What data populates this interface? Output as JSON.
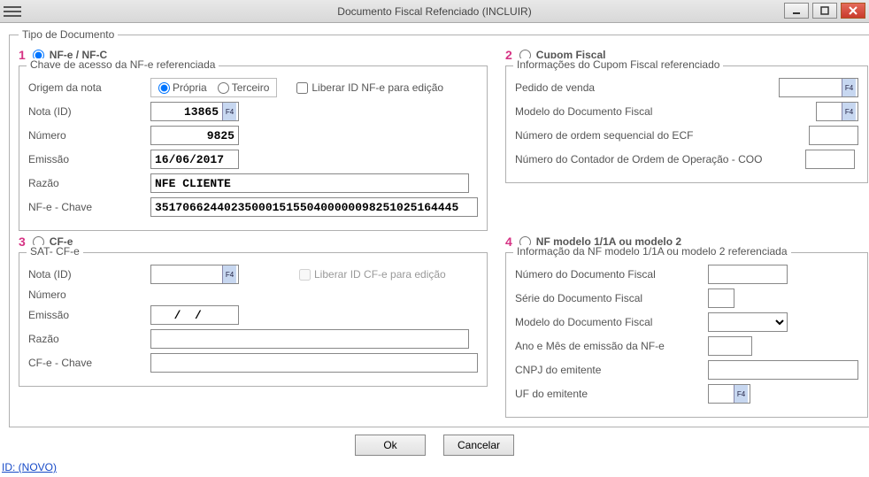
{
  "window": {
    "title": "Documento Fiscal Refenciado (INCLUIR)"
  },
  "legend_tipo": "Tipo de Documento",
  "badges": {
    "b1": "1",
    "b2": "2",
    "b3": "3",
    "b4": "4"
  },
  "sec1": {
    "radio_label": "NF-e / NF-C",
    "subtitle": "Chave de acesso da NF-e referenciada",
    "origem_label": "Origem da nota",
    "origem_propria": "Própria",
    "origem_terceiro": "Terceiro",
    "liberar_label": "Liberar ID NF-e para edição",
    "nota_label": "Nota (ID)",
    "nota_value": "13865",
    "numero_label": "Número",
    "numero_value": "9825",
    "emissao_label": "Emissão",
    "emissao_value": "16/06/2017",
    "razao_label": "Razão",
    "razao_value": "NFE CLIENTE",
    "chave_label": "NF-e - Chave",
    "chave_value": "35170662440235000151550400000098251025164445"
  },
  "sec2": {
    "radio_label": "Cupom Fiscal",
    "subtitle": "Informações do Cupom Fiscal referenciado",
    "pedido_label": "Pedido de venda",
    "modelo_label": "Modelo do Documento Fiscal",
    "ordem_label": "Número de ordem sequencial do ECF",
    "coo_label": "Número do Contador de Ordem de Operação - COO"
  },
  "sec3": {
    "radio_label": "CF-e",
    "subtitle": "SAT- CF-e",
    "nota_label": "Nota (ID)",
    "liberar_label": "Liberar ID CF-e para edição",
    "numero_label": "Número",
    "emissao_label": "Emissão",
    "emissao_value": "  /  /    ",
    "razao_label": "Razão",
    "chave_label": "CF-e - Chave"
  },
  "sec4": {
    "radio_label": "NF modelo 1/1A ou modelo 2",
    "subtitle": "Informação da NF modelo 1/1A ou modelo 2 referenciada",
    "numdoc_label": "Número do Documento Fiscal",
    "serie_label": "Série do Documento Fiscal",
    "modelo_label": "Modelo do Documento Fiscal",
    "anomes_label": "Ano e Mês de emissão da NF-e",
    "cnpj_label": "CNPJ do emitente",
    "uf_label": "UF do emitente"
  },
  "buttons": {
    "ok": "Ok",
    "cancel": "Cancelar"
  },
  "status": "ID: (NOVO)",
  "f4": "F4"
}
